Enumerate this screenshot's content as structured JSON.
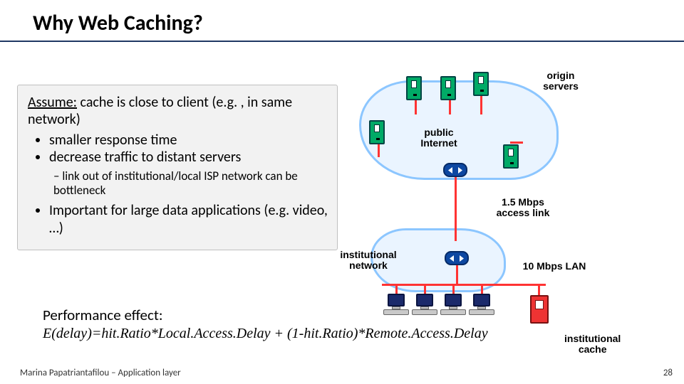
{
  "slide": {
    "title": "Why Web Caching?",
    "assume_lead": "Assume:",
    "assume_rest": " cache is close to client (e.g. , in same network)",
    "bullets": {
      "b1": "smaller response time",
      "b2": "decrease traffic to distant servers",
      "sub1": "link out of institutional/local ISP network can be bottleneck",
      "b3": "Important for large data applications (e.g. video, …)"
    }
  },
  "diagram": {
    "origin_label": "origin\nservers",
    "public_label": "public\nInternet",
    "access_label": "1.5 Mbps\naccess link",
    "inst_label": "institutional\nnetwork",
    "lan_label": "10 Mbps LAN",
    "cache_label": "institutional\ncache"
  },
  "performance": {
    "heading": "Performance effect:",
    "formula": "E(delay)=hit.Ratio*Local.Access.Delay + (1-hit.Ratio)*Remote.Access.Delay"
  },
  "footer": {
    "text": "Marina Papatriantafilou – Application layer",
    "page": "28"
  }
}
